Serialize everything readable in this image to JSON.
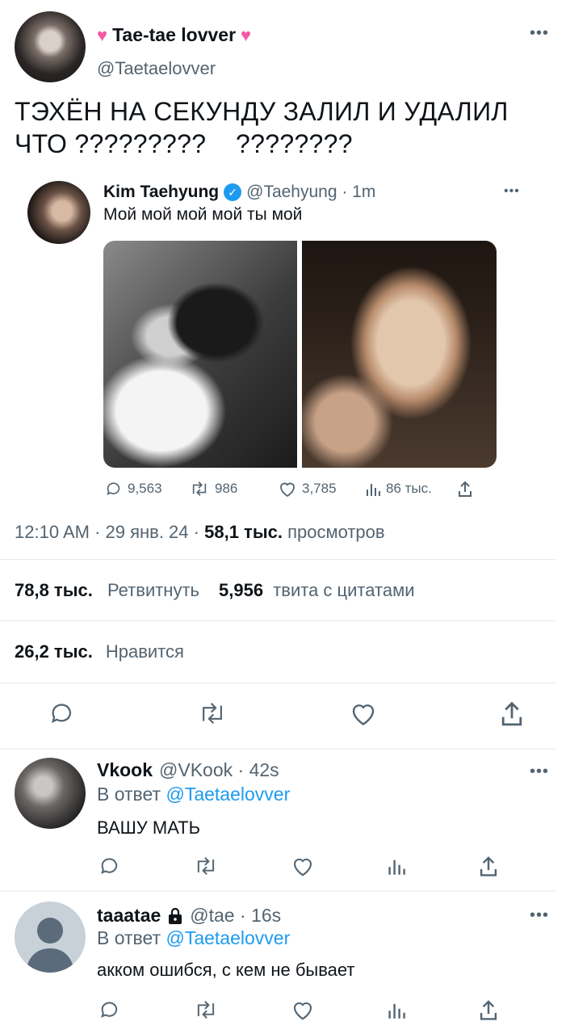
{
  "main_tweet": {
    "display_name": "Tae-tae lovver",
    "handle": "@Taetaelovver",
    "text_line1": "ТЭХЁН НА СЕКУНДУ ЗАЛИЛ И УДАЛИЛ",
    "text_line2": "ЧТО ?????????    ????????",
    "timestamp": "12:10 AM · 29 янв. 24 ·",
    "views_count": "58,1 тыс.",
    "views_label": "просмотров",
    "retweets_count": "78,8 тыс.",
    "retweets_label": "Ретвитнуть",
    "quotes_count": "5,956",
    "quotes_label": "твита с цитатами",
    "likes_count": "26,2 тыс.",
    "likes_label": "Нравится"
  },
  "quoted_tweet": {
    "display_name": "Kim Taehyung",
    "handle_time": "@Taehyung · 1m",
    "text": "Мой мой мой мой ты мой",
    "replies": "9,563",
    "retweets": "986",
    "likes": "3,785",
    "views": "86 тыс."
  },
  "replies": [
    {
      "display_name": "Vkook",
      "handle_time": "@VKook · 42s",
      "reply_prefix": "В ответ",
      "reply_to": "@Taetaelovver",
      "text": "ВАШУ МАТЬ"
    },
    {
      "display_name": "taaatae",
      "handle_time": "@tae · 16s",
      "reply_prefix": "В ответ",
      "reply_to": "@Taetaelovver",
      "text": "акком ошибся, с кем не бывает"
    }
  ],
  "colors": {
    "accent": "#1d9bf0",
    "muted": "#536471",
    "heart": "#f25aa6",
    "divider": "#e5e9ec"
  },
  "icons": [
    "more-icon",
    "heart-emoji-icon",
    "verified-icon",
    "reply-icon",
    "retweet-icon",
    "like-icon",
    "views-icon",
    "share-icon",
    "lock-icon"
  ]
}
